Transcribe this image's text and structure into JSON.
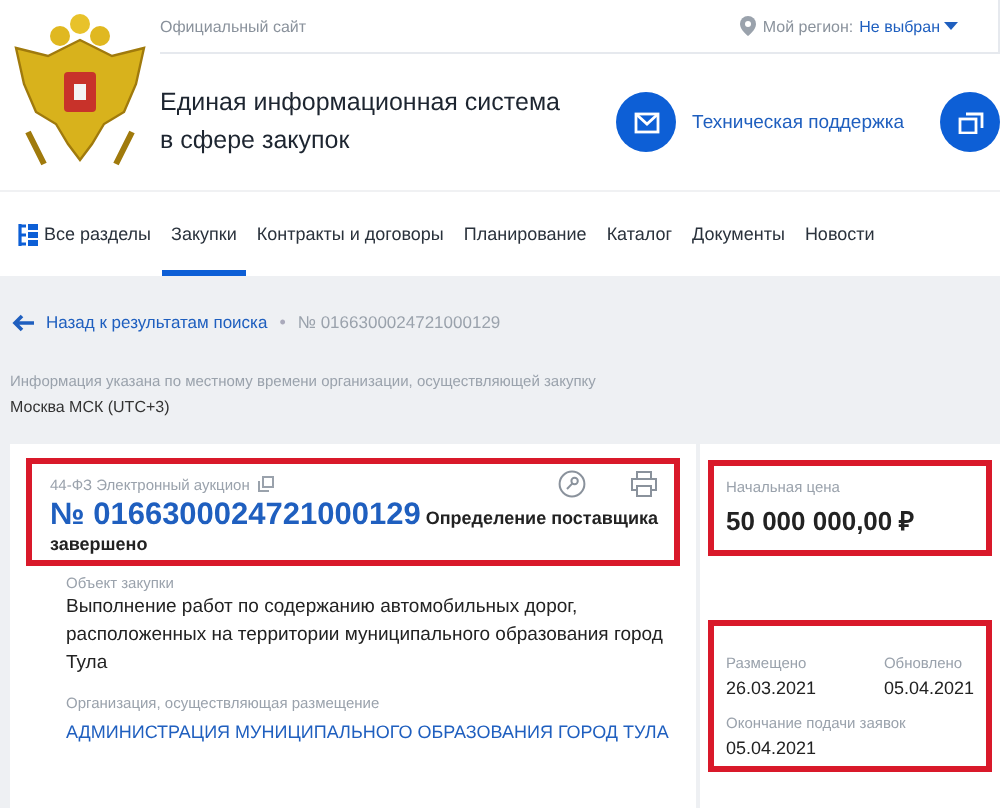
{
  "header": {
    "official": "Официальный сайт",
    "region_label": "Мой регион:",
    "region_value": "Не выбран",
    "title_lines": [
      "Единая информационная система",
      "в сфере закупок"
    ],
    "support": "Техническая поддержка"
  },
  "nav": [
    {
      "label": "Все разделы",
      "kind": "sections",
      "selected": false
    },
    {
      "label": "Закупки",
      "kind": "link",
      "selected": true
    },
    {
      "label": "Контракты и договоры",
      "kind": "link",
      "selected": false
    },
    {
      "label": "Планирование",
      "kind": "link",
      "selected": false
    },
    {
      "label": "Каталог",
      "kind": "link",
      "selected": false
    },
    {
      "label": "Документы",
      "kind": "link",
      "selected": false
    },
    {
      "label": "Новости",
      "kind": "link",
      "selected": false
    }
  ],
  "breadcrumb": {
    "back": "Назад к результатам поиска",
    "separator": "•",
    "current": "№ 0166300024721000129"
  },
  "timezone": {
    "note": "Информация указана по местному времени организации, осуществляющей закупку",
    "value": "Москва МСК (UTC+3)"
  },
  "procurement": {
    "highlighted": true,
    "type": "44-ФЗ Электронный аукцион",
    "number": "№ 0166300024721000129",
    "stage": "Определение поставщика",
    "status": "завершено"
  },
  "details": [
    {
      "label": "Объект закупки",
      "value": "Выполнение работ по содержанию автомобильных дорог, расположенных на территории муниципального образования город Тула",
      "kind": "text"
    },
    {
      "label": "Организация, осуществляющая размещение",
      "value": "АДМИНИСТРАЦИЯ МУНИЦИПАЛЬНОГО ОБРАЗОВАНИЯ ГОРОД ТУЛА",
      "kind": "link"
    }
  ],
  "price": {
    "highlighted": true,
    "label": "Начальная цена",
    "value": "50 000 000,00 ₽"
  },
  "dates": {
    "highlighted": true,
    "items": [
      {
        "label": "Размещено",
        "value": "26.03.2021"
      },
      {
        "label": "Обновлено",
        "value": "05.04.2021"
      },
      {
        "label": "Окончание подачи заявок",
        "value": "05.04.2021"
      }
    ]
  }
}
